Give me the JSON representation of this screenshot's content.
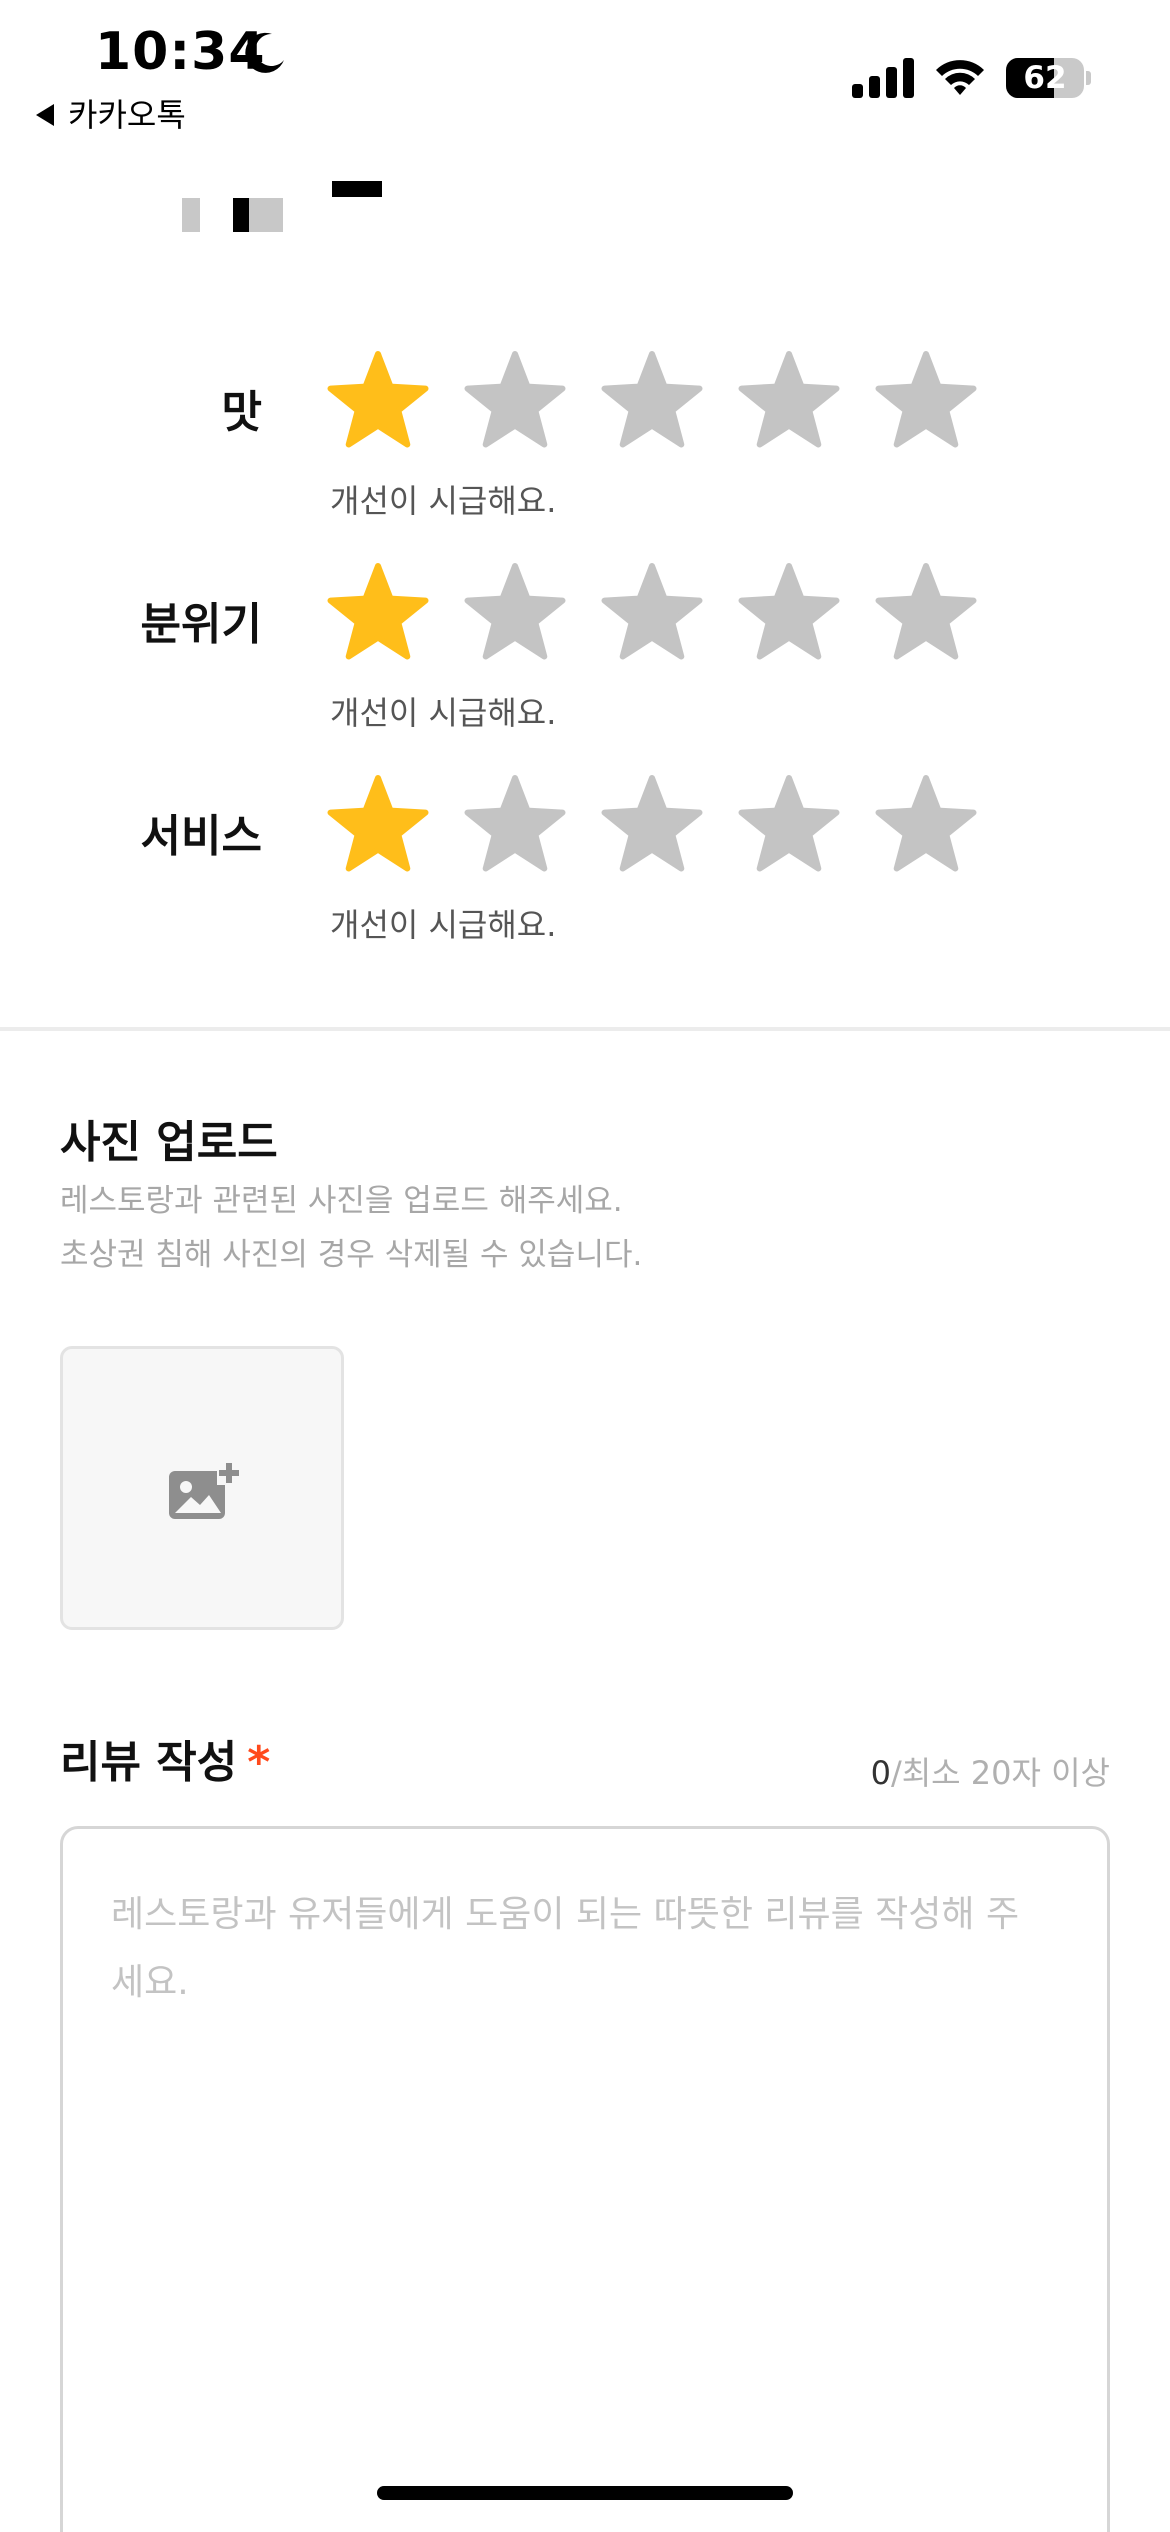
{
  "status_bar": {
    "time": "10:34",
    "back_app": "카카오톡",
    "battery_percent": "62",
    "battery_level": 0.62,
    "icons": [
      "moon-icon",
      "cellular-signal-icon",
      "wifi-icon",
      "battery-icon"
    ]
  },
  "ratings": [
    {
      "label": "맛",
      "score": 1,
      "max": 5,
      "description": "개선이 시급해요."
    },
    {
      "label": "분위기",
      "score": 1,
      "max": 5,
      "description": "개선이 시급해요."
    },
    {
      "label": "서비스",
      "score": 1,
      "max": 5,
      "description": "개선이 시급해요."
    }
  ],
  "photo_upload": {
    "title": "사진 업로드",
    "help_line1": "레스토랑과 관련된 사진을 업로드 해주세요.",
    "help_line2": "초상권 침해 사진의 경우 삭제될 수 있습니다.",
    "button_icon": "add-photo-icon"
  },
  "review": {
    "title": "리뷰 작성",
    "required_mark": "*",
    "char_count": "0",
    "min_text": "/최소 20자 이상",
    "placeholder": "레스토랑과 유저들에게 도움이 되는 따뜻한 리뷰를 작성해 주세요."
  },
  "colors": {
    "star_active": "#FFBE1A",
    "star_inactive": "#C4C4C4",
    "required": "#FF4A1C",
    "divider": "#ECECEC"
  }
}
